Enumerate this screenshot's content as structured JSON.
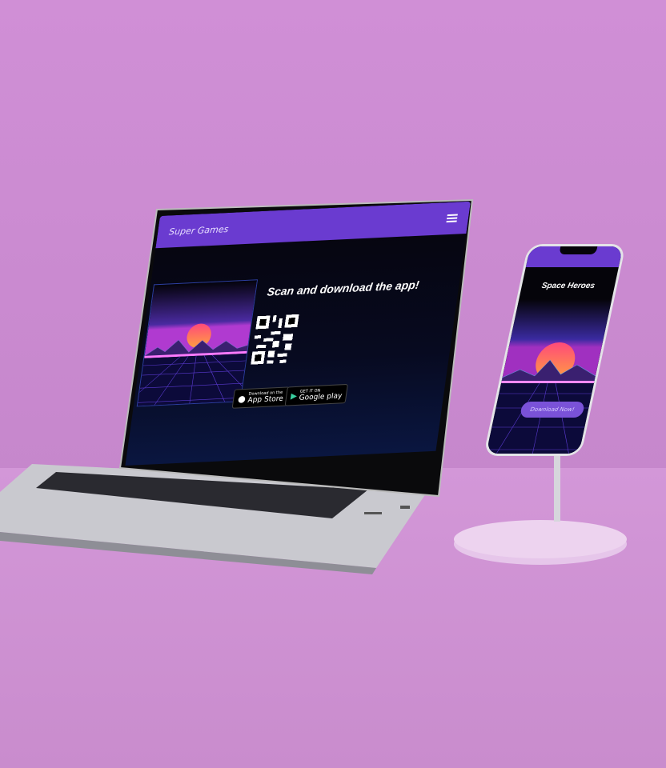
{
  "laptop": {
    "header": {
      "brand": "Super Games",
      "menu_icon": "hamburger-icon"
    },
    "headline": "Scan and download the app!",
    "qr_icon": "qr-code",
    "badges": [
      {
        "small": "Download on the",
        "label": "App Store",
        "icon": "apple-icon"
      },
      {
        "small": "GET IT ON",
        "label": "Google play",
        "icon": "play-store-icon"
      }
    ]
  },
  "phone": {
    "title": "Space Heroes",
    "button": "Download Now!"
  },
  "colors": {
    "accent": "#6a3bd0",
    "background": "#c98ccd",
    "sun": "#ff5a6e"
  }
}
